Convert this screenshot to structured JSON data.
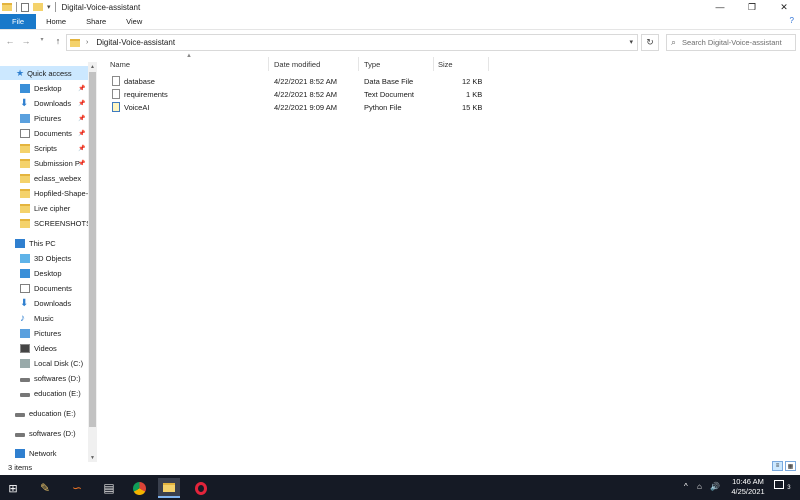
{
  "window": {
    "title": "Digital-Voice-assistant",
    "controls": {
      "minimize": "—",
      "maximize": "❐",
      "close": "✕"
    }
  },
  "ribbon": {
    "tabs": [
      {
        "label": "File",
        "active": true
      },
      {
        "label": "Home"
      },
      {
        "label": "Share"
      },
      {
        "label": "View"
      }
    ],
    "help": "?"
  },
  "addressbar": {
    "path": "Digital-Voice-assistant",
    "search_placeholder": "Search Digital-Voice-assistant"
  },
  "navigation": {
    "quick_access": "Quick access",
    "items": [
      {
        "label": "Desktop",
        "icon": "desktop-icon",
        "pinned": true
      },
      {
        "label": "Downloads",
        "icon": "downloads-icon",
        "pinned": true
      },
      {
        "label": "Pictures",
        "icon": "pictures-icon",
        "pinned": true
      },
      {
        "label": "Documents",
        "icon": "documents-icon",
        "pinned": true
      },
      {
        "label": "Scripts",
        "icon": "folder-icon",
        "pinned": true
      },
      {
        "label": "Submission P",
        "icon": "folder-icon",
        "pinned": true
      },
      {
        "label": "eclass_webex",
        "icon": "folder-icon"
      },
      {
        "label": "Hopfiled-Shape-",
        "icon": "folder-icon"
      },
      {
        "label": "Live cipher",
        "icon": "folder-icon"
      },
      {
        "label": "SCREENSHOTS",
        "icon": "folder-icon"
      }
    ],
    "this_pc": "This PC",
    "pc_items": [
      {
        "label": "3D Objects",
        "icon": "3d-objects-icon"
      },
      {
        "label": "Desktop",
        "icon": "desktop-icon"
      },
      {
        "label": "Documents",
        "icon": "documents-icon"
      },
      {
        "label": "Downloads",
        "icon": "downloads-icon"
      },
      {
        "label": "Music",
        "icon": "music-icon"
      },
      {
        "label": "Pictures",
        "icon": "pictures-icon"
      },
      {
        "label": "Videos",
        "icon": "videos-icon"
      },
      {
        "label": "Local Disk (C:)",
        "icon": "drive-icon"
      },
      {
        "label": "softwares (D:)",
        "icon": "drive-icon"
      },
      {
        "label": "education (E:)",
        "icon": "drive-icon"
      }
    ],
    "extra_drives": [
      {
        "label": "education (E:)"
      },
      {
        "label": "softwares (D:)"
      }
    ],
    "network": "Network"
  },
  "file_list": {
    "columns": [
      "Name",
      "Date modified",
      "Type",
      "Size"
    ],
    "rows": [
      {
        "name": "database",
        "date": "4/22/2021 8:52 AM",
        "type": "Data Base File",
        "size": "12 KB",
        "icon": "file-icon"
      },
      {
        "name": "requirements",
        "date": "4/22/2021 8:52 AM",
        "type": "Text Document",
        "size": "1 KB",
        "icon": "text-file-icon"
      },
      {
        "name": "VoiceAI",
        "date": "4/22/2021 9:09 AM",
        "type": "Python File",
        "size": "15 KB",
        "icon": "python-file-icon"
      }
    ]
  },
  "status_bar": {
    "items_count": "3 items"
  },
  "taskbar": {
    "clock_time": "10:46 AM",
    "clock_date": "4/25/2021",
    "notification_count": "3"
  },
  "colors": {
    "accent": "#1979ca",
    "selection": "#cce8ff",
    "taskbar": "#151a25",
    "folder": "#f4d26b"
  }
}
